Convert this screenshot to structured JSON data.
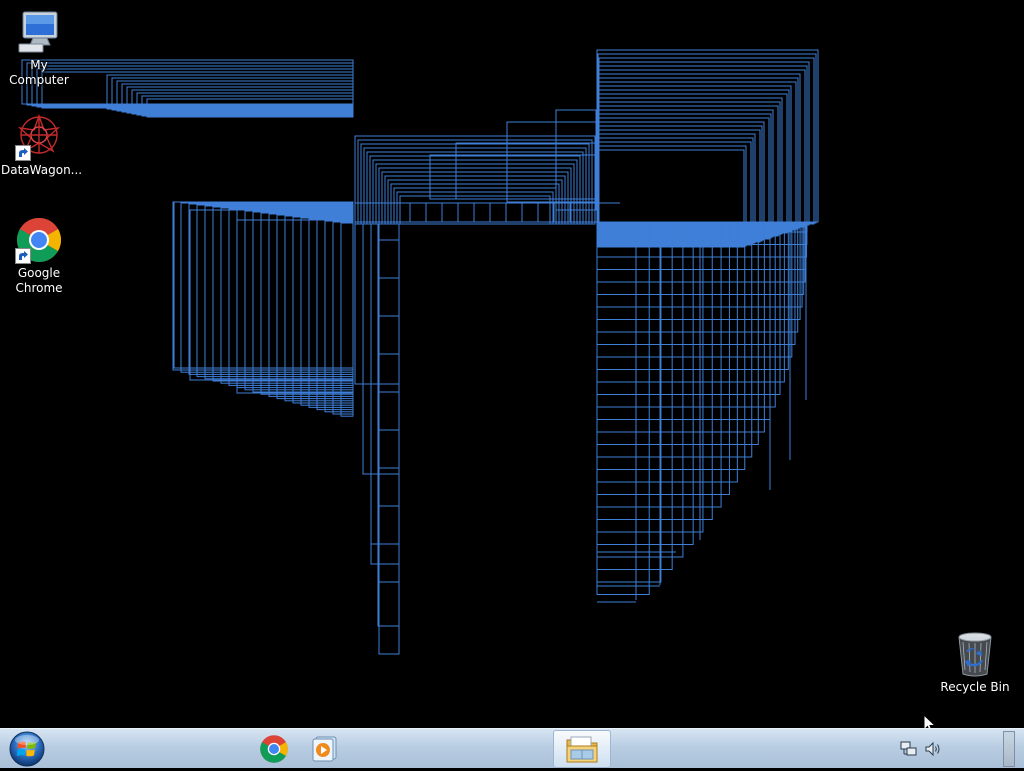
{
  "desktop": {
    "background_color": "#000000",
    "artifact_color": "#3f7fd8",
    "icons": [
      {
        "label": "My Computer",
        "icon": "computer-icon"
      },
      {
        "label": "DataWagon...",
        "icon": "datawagon-icon",
        "shortcut": true
      },
      {
        "label": "Google\nChrome",
        "icon": "chrome-icon",
        "shortcut": true
      },
      {
        "label": "Recycle Bin",
        "icon": "recycle-bin-icon"
      }
    ]
  },
  "taskbar": {
    "start_icon": "windows-start-orb-icon",
    "pinned": [
      {
        "name": "Google Chrome",
        "icon": "chrome-icon"
      },
      {
        "name": "Media Player",
        "icon": "media-player-icon"
      },
      {
        "name": "Windows Explorer",
        "icon": "folder-icon",
        "active": true
      }
    ],
    "tray": [
      {
        "name": "network",
        "icon": "network-icon"
      },
      {
        "name": "volume",
        "icon": "volume-icon"
      }
    ]
  }
}
